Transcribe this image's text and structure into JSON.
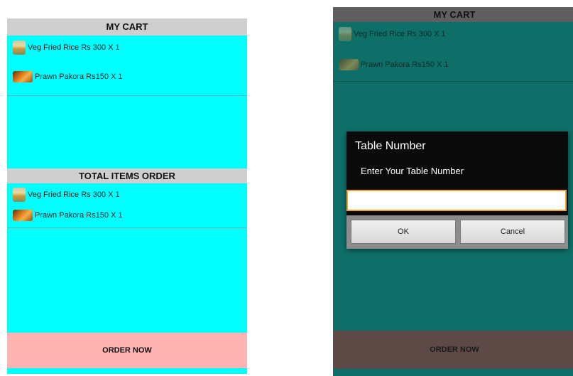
{
  "cart_screen": {
    "cart_header": "MY CART",
    "cart_items": [
      {
        "label": "Veg Fried Rice Rs 300 X 1",
        "icon": "fried-rice-thumbnail"
      },
      {
        "label": "Prawn Pakora Rs150 X 1",
        "icon": "prawn-pakora-thumbnail"
      }
    ],
    "order_header": "TOTAL ITEMS ORDER",
    "order_items": [
      {
        "label": "Veg Fried Rice Rs 300 X 1",
        "icon": "fried-rice-thumbnail"
      },
      {
        "label": "Prawn Pakora Rs150 X 1",
        "icon": "prawn-pakora-thumbnail"
      }
    ],
    "order_button": "ORDER NOW"
  },
  "dialog_screen": {
    "cart_header": "MY CART",
    "cart_items": [
      {
        "label": "Veg Fried Rice Rs 300 X 1",
        "icon": "fried-rice-thumbnail"
      },
      {
        "label": "Prawn Pakora Rs150 X 1",
        "icon": "prawn-pakora-thumbnail"
      }
    ],
    "order_button": "ORDER NOW",
    "dialog": {
      "title": "Table Number",
      "message": "Enter Your Table Number",
      "input_value": "",
      "ok_label": "OK",
      "cancel_label": "Cancel"
    }
  },
  "colors": {
    "cart_background": "#00ffff",
    "header_background": "#cfcfcf",
    "order_button_background": "#ffb3b3",
    "dimmed_background": "#0e6e68",
    "dimmed_order_button": "#5d4a47",
    "dialog_background": "#0a0a0a",
    "input_focus_border": "#f0a030"
  }
}
